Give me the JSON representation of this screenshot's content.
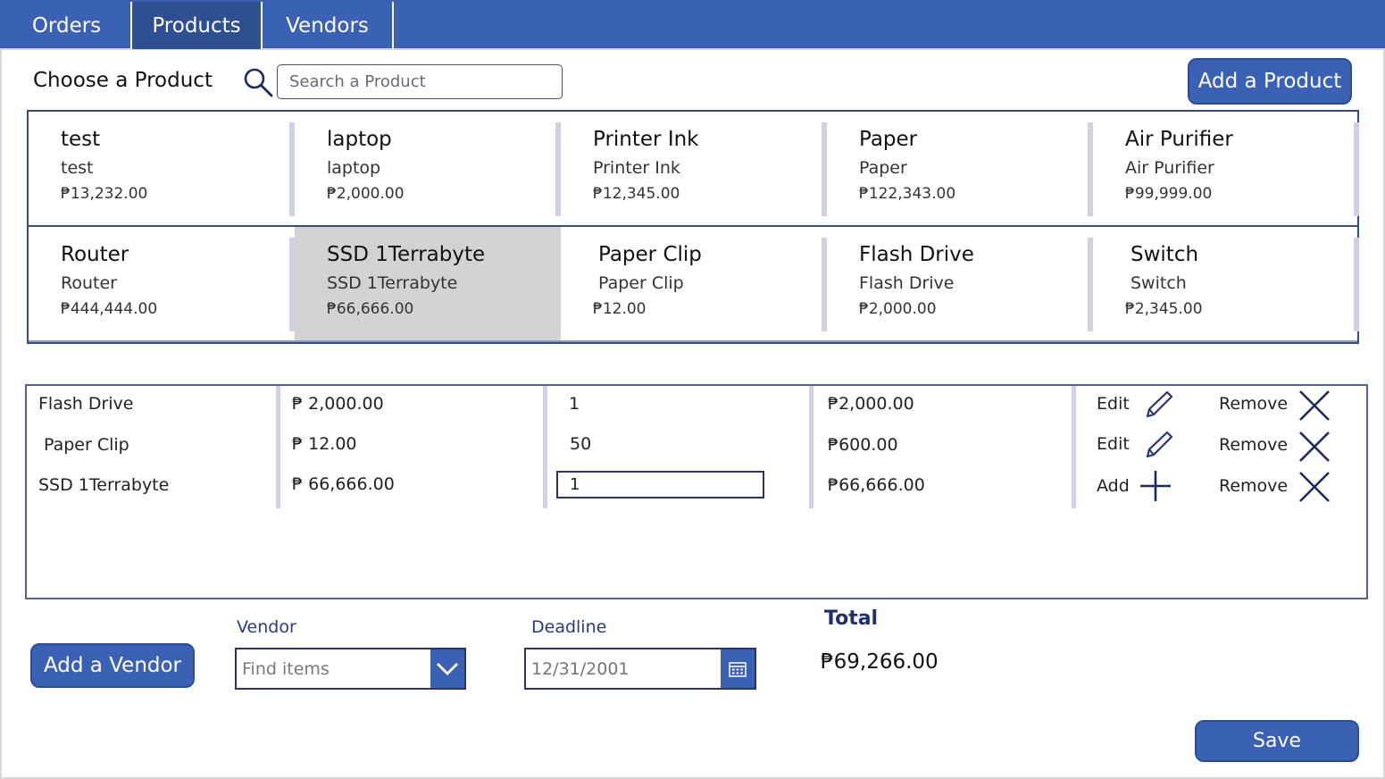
{
  "tabs": [
    {
      "label": "Orders"
    },
    {
      "label": "Products"
    },
    {
      "label": "Vendors"
    }
  ],
  "colors": {
    "accent": "#3b61b4",
    "selected_tab": "#2f4f93",
    "selected_card": "#d3d3d3",
    "border": "#3e4b7e"
  },
  "header": {
    "title": "Choose a Product",
    "search_placeholder": "Search a Product",
    "add_product_label": "Add a Product"
  },
  "products": [
    {
      "name": "test",
      "desc": "test",
      "price": "₱13,232.00"
    },
    {
      "name": "laptop",
      "desc": "laptop",
      "price": "₱2,000.00"
    },
    {
      "name": "Printer Ink",
      "desc": "Printer Ink",
      "price": "₱12,345.00"
    },
    {
      "name": "Paper",
      "desc": "Paper",
      "price": "₱122,343.00"
    },
    {
      "name": "Air Purifier",
      "desc": "Air Purifier",
      "price": "₱99,999.00"
    },
    {
      "name": "Router",
      "desc": "Router",
      "price": "₱444,444.00"
    },
    {
      "name": "SSD 1Terrabyte",
      "desc": "SSD 1Terrabyte",
      "price": "₱66,666.00",
      "selected": true
    },
    {
      "name": "Paper Clip",
      "desc": "Paper Clip",
      "price": "₱12.00"
    },
    {
      "name": "Flash Drive",
      "desc": "Flash Drive",
      "price": "₱2,000.00"
    },
    {
      "name": "Switch",
      "desc": "Switch",
      "price": "₱2,345.00"
    }
  ],
  "order_lines": [
    {
      "product": "Flash Drive",
      "unit_price": "₱ 2,000.00",
      "qty": "1",
      "subtotal": "₱2,000.00",
      "action_label": "Edit",
      "action_icon": "pencil-icon",
      "remove_label": "Remove"
    },
    {
      "product": "Paper Clip",
      "unit_price": "₱ 12.00",
      "qty": "50",
      "subtotal": "₱600.00",
      "action_label": "Edit",
      "action_icon": "pencil-icon",
      "remove_label": "Remove"
    },
    {
      "product": "SSD 1Terrabyte",
      "unit_price": "₱ 66,666.00",
      "qty": "1",
      "subtotal": "₱66,666.00",
      "action_label": "Add",
      "action_icon": "plus-icon",
      "remove_label": "Remove"
    }
  ],
  "form": {
    "add_vendor_label": "Add a Vendor",
    "vendor_label": "Vendor",
    "vendor_placeholder": "Find items",
    "deadline_label": "Deadline",
    "deadline_placeholder": "12/31/2001",
    "total_label": "Total",
    "total_value": "₱69,266.00",
    "save_label": "Save"
  }
}
